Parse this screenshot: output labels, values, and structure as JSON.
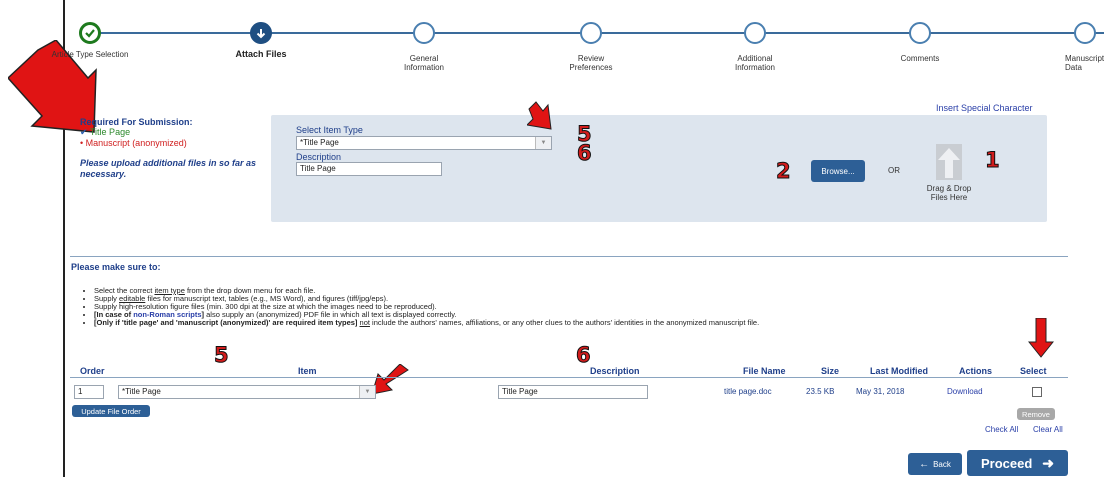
{
  "stepper": {
    "steps": [
      {
        "label": "Article Type Selection",
        "state": "done"
      },
      {
        "label": "Attach Files",
        "state": "current"
      },
      {
        "label": "General Information",
        "state": "todo"
      },
      {
        "label": "Review Preferences",
        "state": "todo"
      },
      {
        "label": "Additional Information",
        "state": "todo"
      },
      {
        "label": "Comments",
        "state": "todo"
      },
      {
        "label": "Manuscript Data",
        "state": "todo"
      }
    ]
  },
  "required": {
    "title": "Required For Submission:",
    "ok_item": "Title Page",
    "missing_item": "Manuscript (anonymized)",
    "note": "Please upload additional files in so far as necessary."
  },
  "insert_special": "Insert Special Character",
  "upload": {
    "select_label": "Select Item Type",
    "select_value": "*Title Page",
    "description_label": "Description",
    "description_value": "Title Page",
    "browse_label": "Browse...",
    "or_label": "OR",
    "drop_label": "Drag & Drop Files Here"
  },
  "annotations": {
    "n5": "5",
    "n6": "6",
    "n2": "2",
    "n1": "1",
    "t5": "5",
    "t6": "6"
  },
  "instructions": {
    "heading": "Please make sure to:",
    "bullets": [
      {
        "pre": "Select the correct ",
        "u": "item type",
        "post": " from the drop down menu for each file."
      },
      {
        "pre": "Supply ",
        "u": "editable",
        "post": " files for manuscript text, tables (e.g., MS Word), and figures (tiff/jpg/eps)."
      },
      {
        "pre": "Supply high-resolution figure files (min. 300 dpi at the size at which the images need to be reproduced).",
        "u": "",
        "post": ""
      }
    ],
    "bullet4_a": "[In case of ",
    "bullet4_b": "non-Roman scripts",
    "bullet4_c": "]",
    "bullet4_d": " also supply an (anonymized) PDF file in which all text is displayed correctly.",
    "bullet5_a": "[Only if 'title page' and 'manuscript (anonymized)' are required item types]",
    "bullet5_b": " ",
    "bullet5_u": "not",
    "bullet5_c": " include the authors' names, affiliations, or any other clues to the authors' identities in the anonymized manuscript file."
  },
  "table": {
    "headers": {
      "order": "Order",
      "item": "Item",
      "description": "Description",
      "file_name": "File Name",
      "size": "Size",
      "last_modified": "Last Modified",
      "actions": "Actions",
      "select": "Select"
    },
    "row": {
      "order": "1",
      "item": "*Title Page",
      "description": "Title Page",
      "file_name": "title page.doc",
      "size": "23.5 KB",
      "last_modified": "May 31, 2018",
      "action": "Download"
    }
  },
  "buttons": {
    "update_order": "Update File Order",
    "remove": "Remove",
    "check_all": "Check All",
    "clear_all": "Clear All",
    "back": "Back",
    "proceed": "Proceed"
  },
  "colors": {
    "accent": "#2d5f96",
    "annotation_red": "#d21c1c",
    "done_green": "#1e7a1e",
    "panel_bg": "#dde5ee"
  }
}
